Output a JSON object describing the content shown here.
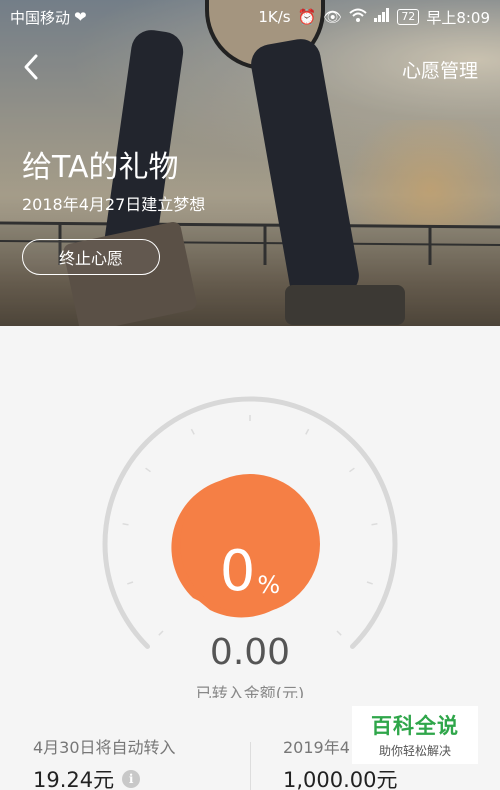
{
  "status_bar": {
    "carrier": "中国移动",
    "speed": "1K/s",
    "battery": "72",
    "time": "早上8:09"
  },
  "header": {
    "manage_label": "心愿管理"
  },
  "wish": {
    "title": "给TA的礼物",
    "created": "2018年4月27日建立梦想",
    "stop_label": "终止心愿"
  },
  "progress": {
    "percent_value": "0",
    "percent_symbol": "%",
    "percent_fraction": 0,
    "amount": "0.00",
    "amount_label": "已转入金额(元)"
  },
  "stats": {
    "left_label": "4月30日将自动转入",
    "left_value": "19.24元",
    "right_label": "2019年4",
    "right_value": "1,000.00元"
  },
  "watermark": {
    "title": "百科全说",
    "subtitle": "助你轻松解决"
  },
  "colors": {
    "accent": "#f57f45",
    "gauge_track": "#d8d8d8"
  }
}
